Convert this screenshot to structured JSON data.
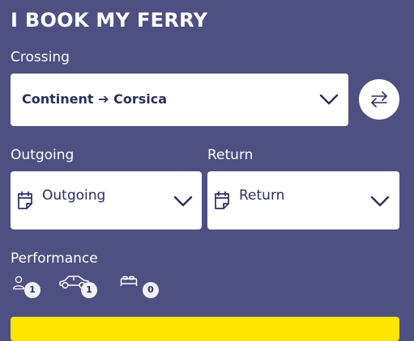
{
  "app": {
    "title": "I BOOK MY FERRY"
  },
  "crossing": {
    "label": "Crossing",
    "value": "Continent ➔ Corsica"
  },
  "outgoing": {
    "label": "Outgoing",
    "placeholder": "Outgoing"
  },
  "return": {
    "label": "Return",
    "placeholder": "Return"
  },
  "performance": {
    "label": "Performance",
    "passengers": "1",
    "vehicles": "1",
    "cabins": "0"
  },
  "icons": {
    "swap": "swap-arrows-icon",
    "calendar": "calendar-icon",
    "chevron": "chevron-down-icon",
    "passenger": "person-icon",
    "vehicle": "car-icon",
    "cabin": "bed-icon"
  },
  "colors": {
    "background": "#4d5080",
    "text_dark": "#2b2f5e",
    "cta": "#ffe600"
  }
}
